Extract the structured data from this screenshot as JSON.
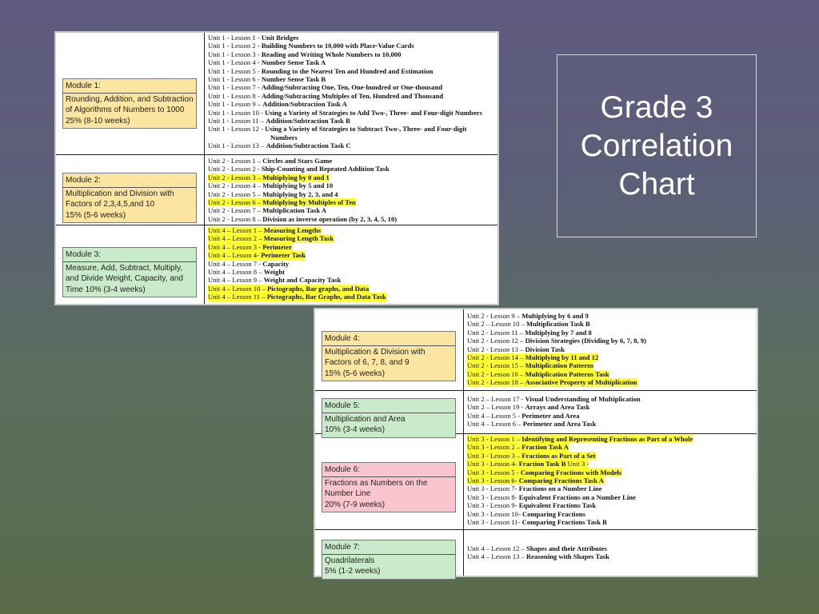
{
  "title": {
    "line1": "Grade 3",
    "line2": "Correlation",
    "line3": "Chart"
  },
  "colors": {
    "highlight": "#ffff33",
    "yellow": "#fbe5a0",
    "green": "#c9ebc9",
    "pink": "#f9c5cf"
  },
  "modules": [
    {
      "heading": "Module 1:",
      "body": [
        "Rounding, Addition, and Subtraction",
        "of Algorithms of Numbers to 1000",
        "25% (8-10 weeks)"
      ],
      "color": "yellow",
      "lessons": [
        {
          "prefix": "Unit 1 - Lesson 1 - ",
          "title": "Unit Bridges",
          "hl": false
        },
        {
          "prefix": "Unit 1 - Lesson 2 - ",
          "title": "Building Numbers to 10,000 with Place-Value Cards",
          "hl": false
        },
        {
          "prefix": "Unit 1 - Lesson 3 - ",
          "title": "Reading and Writing Whole Numbers to 10,000",
          "hl": false
        },
        {
          "prefix": "Unit 1 - Lesson 4 - ",
          "title": "Number Sense Task A",
          "hl": false
        },
        {
          "prefix": "Unit 1 - Lesson 5 - ",
          "title": "Rounding to the Nearest Ten and Hundred and Estimation",
          "hl": false
        },
        {
          "prefix": "Unit 1 - Lesson 6 - ",
          "title": "Number Sense Task B",
          "hl": false
        },
        {
          "prefix": "Unit 1 - Lesson 7 - ",
          "title": "Adding/Subtracting One, Ten, One-hundred or One-thousand",
          "hl": false
        },
        {
          "prefix": "Unit 1 - Lesson 8 - ",
          "title": "Adding/Subtracting Multiples of Ten, Hundred and Thousand",
          "hl": false
        },
        {
          "prefix": "Unit 1 - Lesson 9 – ",
          "title": "Addition/Subtraction Task A",
          "hl": false
        },
        {
          "prefix": "Unit 1 - Lesson 10 - ",
          "title": "Using a Variety of Strategies to Add Two-, Three- and Four-digit Numbers",
          "hl": false
        },
        {
          "prefix": "Unit 1 - Lesson 11 – ",
          "title": "Addition/Subtraction Task B",
          "hl": false
        },
        {
          "prefix": "Unit 1 - Lesson 12 - ",
          "title": "Using a Variety of Strategies to Subtract Two-, Three- and Four-digit",
          "title2": "Numbers",
          "hl": false
        },
        {
          "prefix": "Unit 1 - Lesson 13 – ",
          "title": "Addition/Subtraction Task C",
          "hl": false
        }
      ]
    },
    {
      "heading": "Module 2:",
      "body": [
        "Multiplication and Division with",
        "Factors of 2,3,4,5,and 10",
        "15% (5-6 weeks)"
      ],
      "color": "yellow",
      "lessons": [
        {
          "prefix": "Unit 2 - Lesson 1 – ",
          "title": "Circles and Stars Game",
          "hl": false
        },
        {
          "prefix": "Unit 2 - Lesson 2 - ",
          "title": "Ship-Counting and Repeated Addition Task",
          "hl": false
        },
        {
          "prefix": "Unit 2 - Lesson 3 – ",
          "title": "Multiplying by 0 and 1",
          "hl": true
        },
        {
          "prefix": "Unit 2 - Lesson 4 – ",
          "title": "Multiplying by 5 and 10",
          "hl": false
        },
        {
          "prefix": "Unit 2 - Lesson 5 – ",
          "title": "Multiplying by 2, 3, and 4",
          "hl": false
        },
        {
          "prefix": "Unit 2 - Lesson 6 – ",
          "title": "Multiplying by Multiples of Ten",
          "hl": true
        },
        {
          "prefix": "Unit 2 - Lesson 7 – ",
          "title": "Multiplication Task A",
          "hl": false
        },
        {
          "prefix": "Unit 2 - Lesson 8 – ",
          "title": "Division as inverse operation (by 2, 3, 4, 5, 10)",
          "hl": false
        }
      ]
    },
    {
      "heading": "Module 3:",
      "body": [
        "Measure, Add, Subtract, Multiply,",
        "and Divide Weight, Capacity, and",
        "Time 10% (3-4 weeks)"
      ],
      "color": "green",
      "lessons": [
        {
          "prefix": "Unit 4 – Lesson 1 – ",
          "title": "Measuring Lengths",
          "hl": true
        },
        {
          "prefix": "Unit 4 – Lesson 2 – ",
          "title": "Measuring Length Task",
          "hl": true
        },
        {
          "prefix": "Unit 4 – Lesson 3 - ",
          "title": "Perimeter",
          "hl": true
        },
        {
          "prefix": "Unit 4 – Lesson 4- ",
          "title": "Perimeter Task",
          "hl": true
        },
        {
          "prefix": "Unit 4 – Lesson 7 - ",
          "title": "Capacity",
          "hl": false
        },
        {
          "prefix": "Unit 4 – Lesson 8 – ",
          "title": "Weight",
          "hl": false
        },
        {
          "prefix": "Unit 4 – Lesson 9 – ",
          "title": "Weight and Capacity Task",
          "hl": false
        },
        {
          "prefix": "Unit 4 – Lesson 10 – ",
          "title": "Pictographs, Bar graphs, and Data",
          "hl": true
        },
        {
          "prefix": "Unit 4 – Lesson 11 – ",
          "title": "Pictographs, Bar Graphs, and Data Task",
          "hl": true
        }
      ]
    },
    {
      "heading": "Module 4:",
      "body": [
        "Multiplication & Division with",
        "Factors of 6, 7, 8, and 9",
        "15% (5-6 weeks)"
      ],
      "color": "yellow",
      "lessons": [
        {
          "prefix": "Unit 2 - Lesson 9 – ",
          "title": "Multiplying by 6 and 9",
          "hl": false
        },
        {
          "prefix": "Unit 2 – Lesson 10 – ",
          "title": "Multiplication Task B",
          "hl": false
        },
        {
          "prefix": "Unit 2 - Lesson 11 – ",
          "title": "Multiplying by 7 and 8",
          "hl": false
        },
        {
          "prefix": "Unit 2 - Lesson 12 – ",
          "title": "Division Strategies (Dividing by 6, 7, 8, 9)",
          "hl": false
        },
        {
          "prefix": "Unit 2 - Lesson 13 – ",
          "title": "Division Task",
          "hl": false
        },
        {
          "prefix": "Unit 2 - Lesson 14 – ",
          "title": "Multiplying by 11 and 12",
          "hl": true
        },
        {
          "prefix": "Unit 2 - Lesson 15 – ",
          "title": "Multiplication Patterns",
          "hl": true
        },
        {
          "prefix": "Unit 2 - Lesson 16 – ",
          "title": "Multiplication Patterns Task",
          "hl": true
        },
        {
          "prefix": "Unit 2 - Lesson 18 – ",
          "title": "Associative Property of Multiplication",
          "hl": true
        }
      ]
    },
    {
      "heading": "Module 5:",
      "body": [
        "Multiplication and Area",
        "10% (3-4 weeks)"
      ],
      "color": "green",
      "lessons": [
        {
          "prefix": "Unit 2 – Lesson 17 - ",
          "title": "Visual Understanding of Multiplication",
          "hl": false
        },
        {
          "prefix": "Unit 2 – Lesson 19 -  ",
          "title": "Arrays and Area Task",
          "hl": false
        },
        {
          "prefix": "Unit 4 – Lesson 5 - ",
          "title": "Perimeter and Area",
          "hl": false
        },
        {
          "prefix": "Unit 4 – Lesson 6 – ",
          "title": "Perimeter and Area Task",
          "hl": false
        }
      ]
    },
    {
      "heading": "Module 6:",
      "body": [
        "Fractions as Numbers on the",
        "Number Line",
        "20% (7-9 weeks)"
      ],
      "color": "pink",
      "lessons": [
        {
          "prefix": "Unit 3 - Lesson 1 – ",
          "title": "Identifying and Representing Fractions as Part of a Whole",
          "hl": true
        },
        {
          "prefix": "Unit 3 - Lesson 2 – ",
          "title": "Fraction Task A",
          "hl": true
        },
        {
          "prefix": "Unit 3 - Lesson 3 – ",
          "title": "Fractions as Part of a Set",
          "hl": true
        },
        {
          "prefix": "Unit 3 - Lesson 4- ",
          "title": "Fraction Task B",
          "suffix": " Unit 3 -",
          "hl": true
        },
        {
          "prefix": "Unit 3 - Lesson 5 - ",
          "title": "Comparing Fractions with Models",
          "hl": true
        },
        {
          "prefix": "Unit 3 - Lesson 6- ",
          "title": "Comparing Fractions Task A",
          "hl": true
        },
        {
          "prefix": "Unit 3 - Lesson 7- ",
          "title": "Fractions on a Number Line",
          "hl": false
        },
        {
          "prefix": "Unit 3 - Lesson 8- ",
          "title": "Equivalent Fractions on a Number Line",
          "hl": false
        },
        {
          "prefix": "Unit 3 - Lesson 9- ",
          "title": "Equivalent Fractions Task",
          "hl": false
        },
        {
          "prefix": "Unit 3 - Lesson 10- ",
          "title": "Comparing Fractions",
          "hl": false
        },
        {
          "prefix": "Unit 3 - Lesson 11- ",
          "title": "Comparing Fractions Task B",
          "hl": false
        }
      ]
    },
    {
      "heading": "Module 7:",
      "body": [
        "Quadrilaterals",
        "5% (1-2 weeks)"
      ],
      "color": "green",
      "lessons": [
        {
          "prefix": "Unit 4 – Lesson 12 – ",
          "title": "Shapes and their Attributes",
          "hl": false
        },
        {
          "prefix": "Unit 4 – Lesson 13 – ",
          "title": "Reasoning with Shapes Task",
          "hl": false
        }
      ]
    }
  ]
}
